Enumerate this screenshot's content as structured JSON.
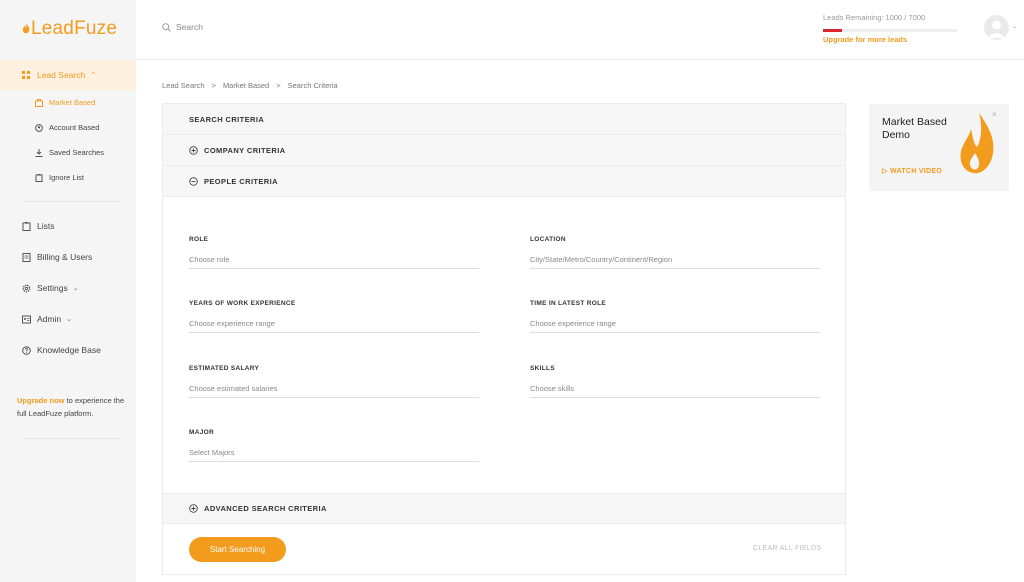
{
  "brand": {
    "name": "LeadFuze",
    "accent": "#f29b1d"
  },
  "sidebar": {
    "main_label": "Lead Search",
    "sub_items": [
      {
        "label": "Market Based",
        "icon": "grid-icon"
      },
      {
        "label": "Account Based",
        "icon": "account-icon"
      },
      {
        "label": "Saved Searches",
        "icon": "download-icon"
      },
      {
        "label": "Ignore List",
        "icon": "clipboard-icon"
      }
    ],
    "items": [
      {
        "label": "Lists",
        "icon": "clipboard-icon"
      },
      {
        "label": "Billing & Users",
        "icon": "receipt-icon"
      },
      {
        "label": "Settings",
        "icon": "gear-icon"
      },
      {
        "label": "Admin",
        "icon": "admin-icon"
      },
      {
        "label": "Knowledge Base",
        "icon": "help-icon"
      }
    ],
    "upgrade_link": "Upgrade now",
    "upgrade_text": " to experience the full LeadFuze platform."
  },
  "header": {
    "search_placeholder": "Search",
    "leads_remaining": "Leads Remaining: 1000 / 7000",
    "leads_progress": 0.14,
    "upgrade_label": "Upgrade for more leads"
  },
  "breadcrumb": [
    "Lead Search",
    "Market Based",
    "Search Criteria"
  ],
  "panel": {
    "search_criteria": "SEARCH CRITERIA",
    "company_criteria": "COMPANY CRITERIA",
    "people_criteria": "PEOPLE CRITERIA",
    "advanced_criteria": "ADVANCED SEARCH CRITERIA",
    "fields": {
      "role": {
        "label": "ROLE",
        "placeholder": "Choose role"
      },
      "location": {
        "label": "LOCATION",
        "placeholder": "City/State/Metro/Country/Continent/Region"
      },
      "experience": {
        "label": "YEARS OF WORK EXPERIENCE",
        "placeholder": "Choose experience range"
      },
      "time_in_role": {
        "label": "TIME IN LATEST ROLE",
        "placeholder": "Choose experience range"
      },
      "salary": {
        "label": "ESTIMATED SALARY",
        "placeholder": "Choose estimated salaries"
      },
      "skills": {
        "label": "SKILLS",
        "placeholder": "Choose skills"
      },
      "major": {
        "label": "MAJOR",
        "placeholder": "Select Majors"
      }
    },
    "start_button": "Start Searching",
    "clear_button": "CLEAR ALL FIELDS"
  },
  "demo": {
    "title": "Market Based Demo",
    "watch": "WATCH VIDEO",
    "close": "×"
  }
}
